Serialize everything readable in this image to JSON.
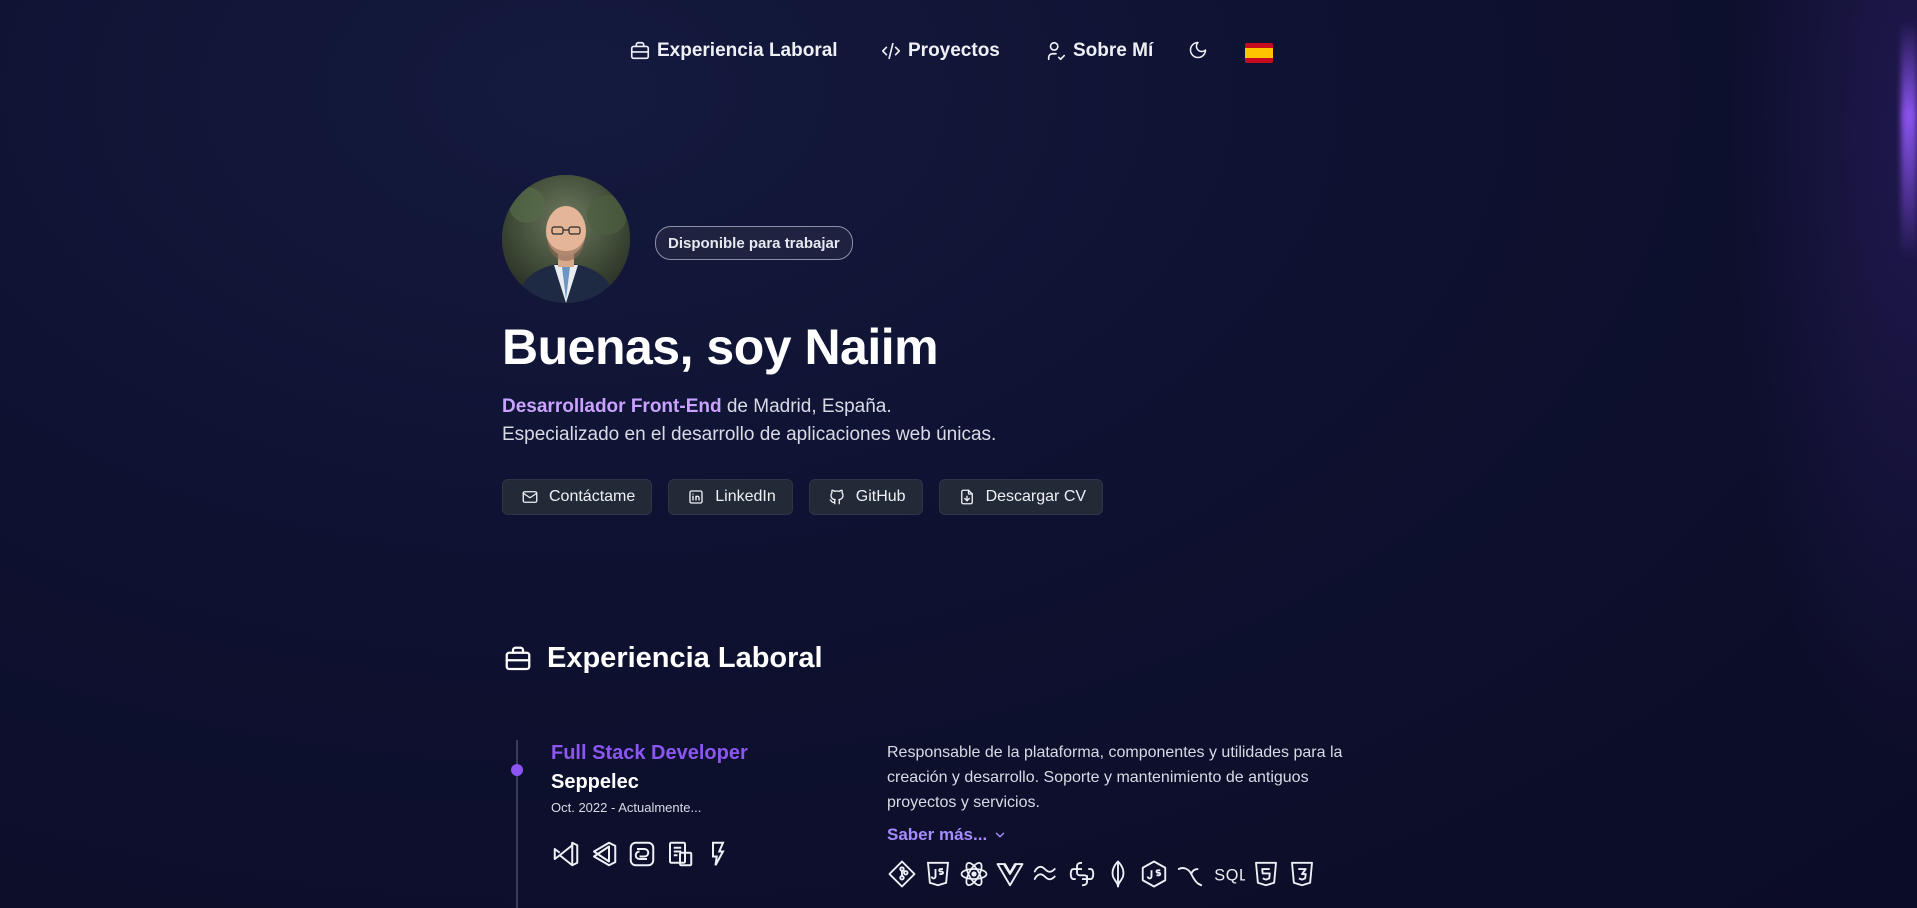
{
  "nav": {
    "experience": "Experiencia Laboral",
    "projects": "Proyectos",
    "about": "Sobre Mí",
    "theme_icon": "moon-icon",
    "language_icon": "spain-flag"
  },
  "hero": {
    "badge": "Disponible para trabajar",
    "title": "Buenas, soy Naiim",
    "role": "Desarrollador Front-End",
    "location": " de Madrid, España.",
    "tagline": "Especializado en el desarrollo de aplicaciones web únicas.",
    "buttons": {
      "contact": "Contáctame",
      "linkedin": "LinkedIn",
      "github": "GitHub",
      "cv": "Descargar CV"
    }
  },
  "experience": {
    "section_title": "Experiencia Laboral",
    "jobs": [
      {
        "title": "Full Stack Developer",
        "company": "Seppelec",
        "date": "Oct. 2022 - Actualmente...",
        "description": "Responsable de la plataforma, componentes y utilidades para la creación y desarrollo. Soporte y mantenimiento de antiguos proyectos y servicios.",
        "more_label": "Saber más...",
        "tools_left": [
          "visual-studio-icon",
          "vscode-icon",
          "mantine-icon",
          "ux-icon",
          "jest-icon"
        ],
        "tools_right": [
          "git-icon",
          "javascript-icon",
          "react-icon",
          "vue-icon",
          "tailwind-icon",
          "python-icon",
          "mongodb-icon",
          "nodejs-icon",
          "mysql-icon",
          "sql-icon",
          "html5-icon",
          "css3-icon"
        ]
      }
    ]
  },
  "colors": {
    "accent": "#8b56f2",
    "accent_light": "#c9a3ff",
    "link": "#a58cff",
    "background": "#0e1130",
    "button_bg": "#222a38"
  }
}
